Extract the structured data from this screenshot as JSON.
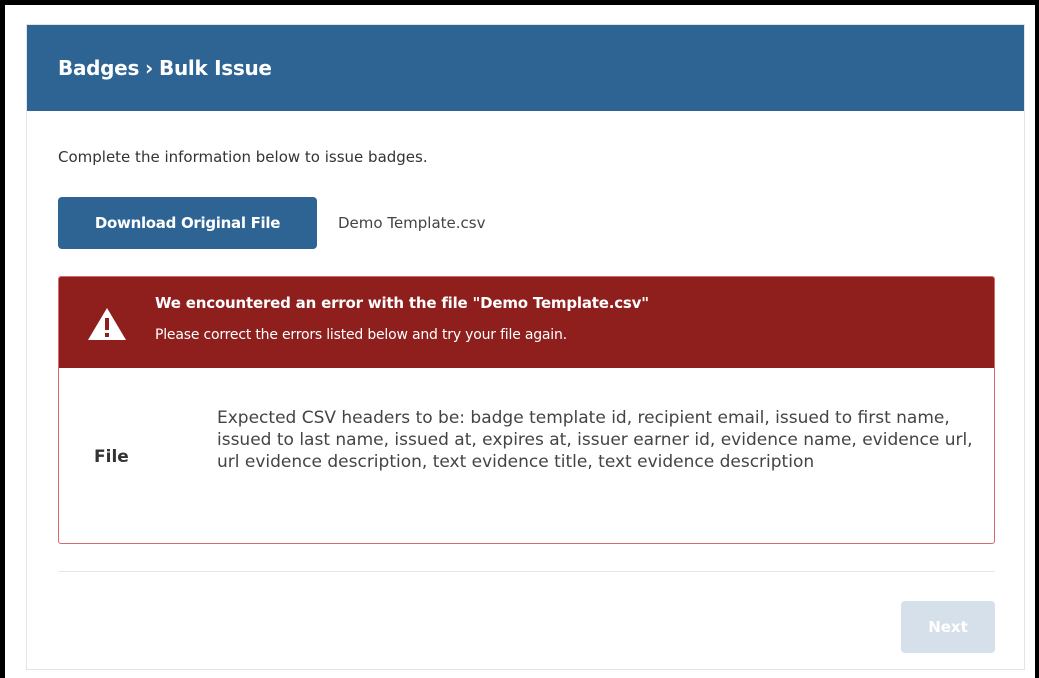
{
  "header": {
    "breadcrumb_root": "Badges",
    "breadcrumb_separator": "›",
    "breadcrumb_current": "Bulk Issue",
    "background_color": "#2d6494"
  },
  "intro_text": "Complete the information below to issue badges.",
  "download": {
    "button_label": "Download Original File",
    "file_name": "Demo Template.csv"
  },
  "error": {
    "icon": "warning-triangle-icon",
    "title": "We encountered an error with the file \"Demo Template.csv\"",
    "subtitle": "Please correct the errors listed below and try your file again.",
    "header_color": "#8e1f1d",
    "rows": [
      {
        "label": "File",
        "message": "Expected CSV headers to be: badge template id, recipient email, issued to first name, issued to last name, issued at, expires at, issuer earner id, evidence name, evidence url, url evidence description, text evidence title, text evidence description"
      }
    ]
  },
  "footer": {
    "next_label": "Next",
    "next_disabled": true
  }
}
